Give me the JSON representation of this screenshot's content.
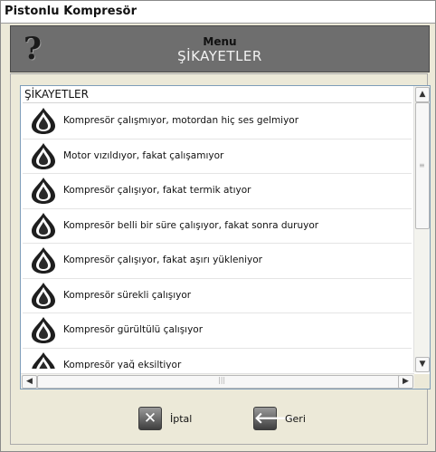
{
  "window": {
    "title": "Pistonlu Kompresör"
  },
  "header": {
    "title": "Menu",
    "subtitle": "ŞİKAYETLER",
    "help_icon": "help-icon"
  },
  "list": {
    "column_header": "ŞİKAYETLER",
    "items": [
      {
        "label": "Kompresör çalışmıyor, motordan hiç ses gelmiyor",
        "icon": "drop-icon"
      },
      {
        "label": "Motor vızıldıyor, fakat çalışamıyor",
        "icon": "drop-icon"
      },
      {
        "label": "Kompresör çalışıyor, fakat termik atıyor",
        "icon": "drop-icon"
      },
      {
        "label": "Kompresör belli bir süre çalışıyor, fakat  sonra duruyor",
        "icon": "drop-icon"
      },
      {
        "label": "Kompresör çalışıyor, fakat aşırı yükleniyor",
        "icon": "drop-icon"
      },
      {
        "label": "Kompresör sürekli çalışıyor",
        "icon": "drop-icon"
      },
      {
        "label": "Kompresör gürültülü çalışıyor",
        "icon": "drop-icon"
      },
      {
        "label": "Kompresör yağ eksiltiyor",
        "icon": "drop-icon"
      }
    ]
  },
  "actions": {
    "cancel": {
      "label": "İptal",
      "icon": "x-icon"
    },
    "back": {
      "label": "Geri",
      "icon": "arrow-left-icon"
    }
  },
  "colors": {
    "header_bg": "#6e6e6e",
    "list_border": "#7f9db9",
    "window_bg": "#ece9d8"
  }
}
